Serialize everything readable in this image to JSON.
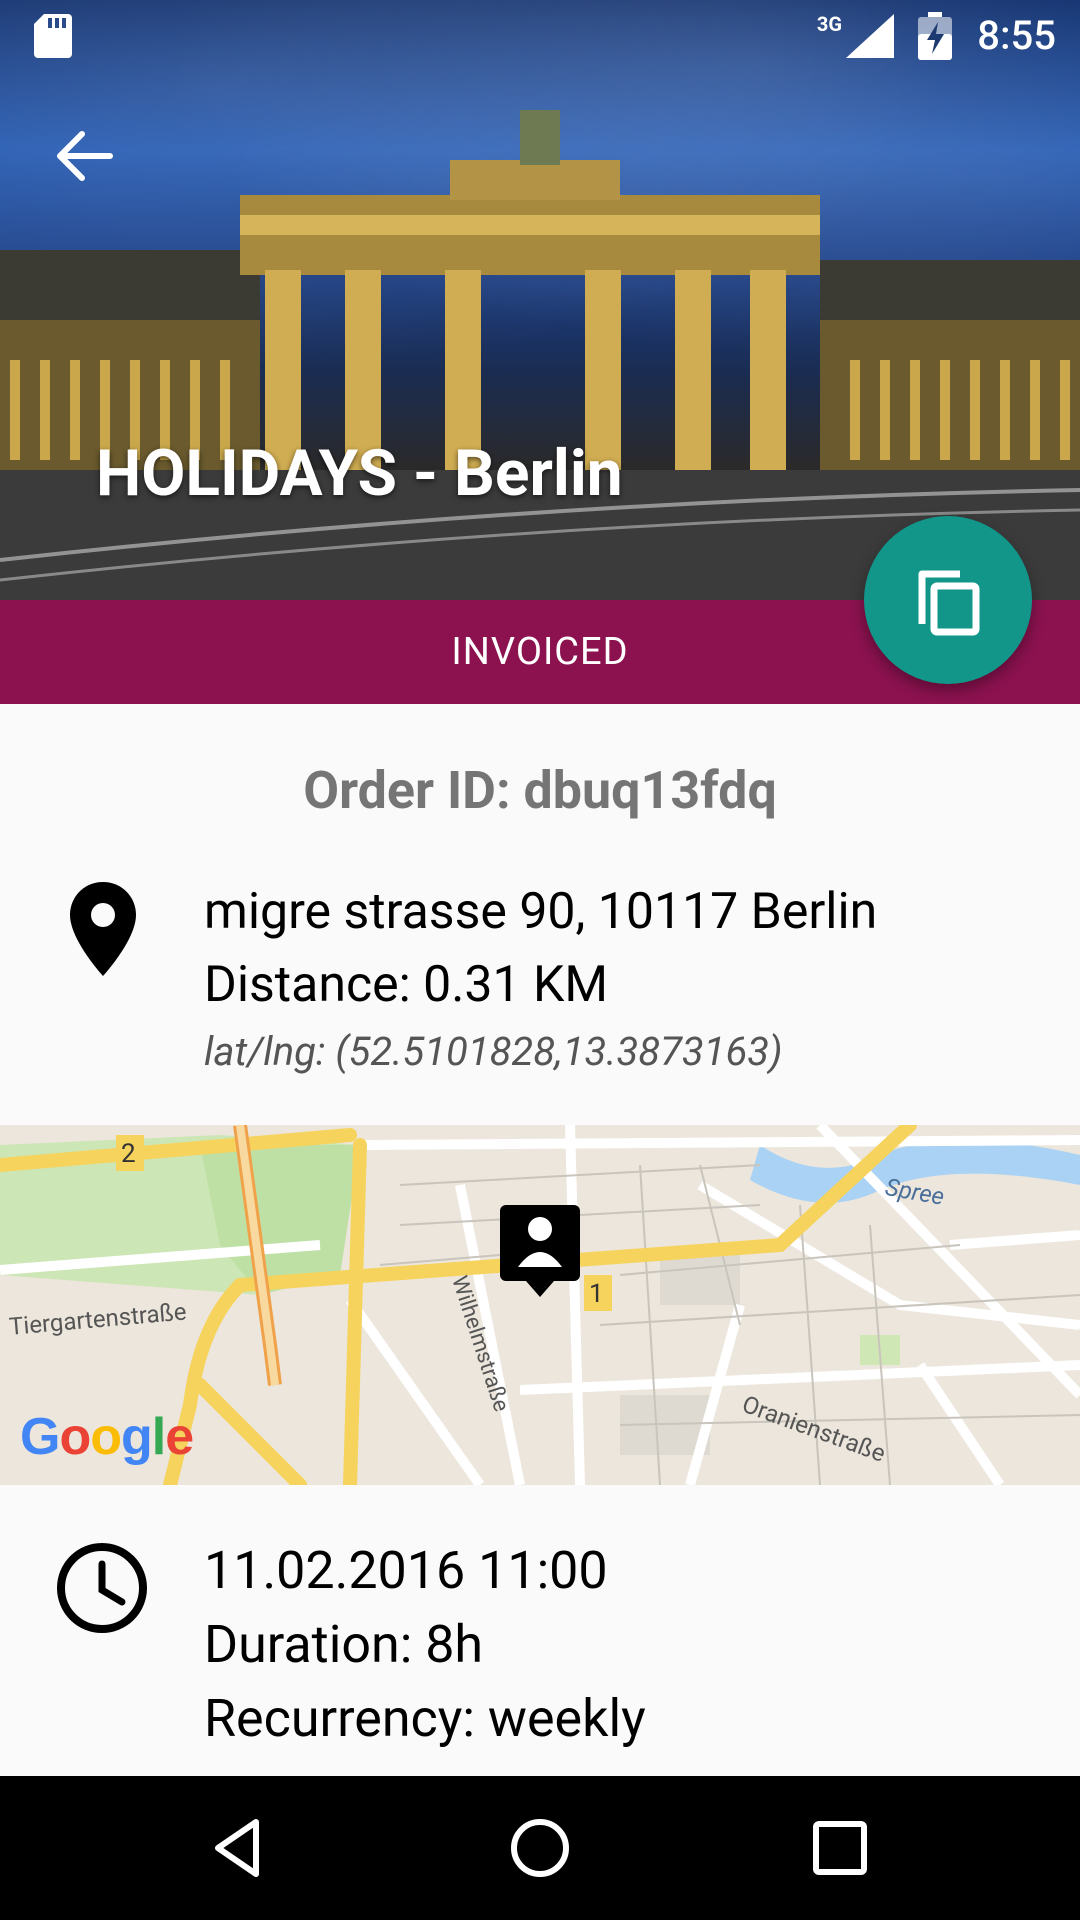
{
  "status_bar": {
    "time": "8:55",
    "network": "3G"
  },
  "header": {
    "title": "HOLIDAYS - Berlin"
  },
  "status": {
    "label": "INVOICED",
    "color": "#8b124f"
  },
  "fab": {
    "icon": "copy-icon",
    "color": "#12968a"
  },
  "order": {
    "id_text": "Order ID: dbuq13fdq"
  },
  "address": {
    "street": "migre strasse 90, 10117 Berlin",
    "distance": "Distance: 0.31 KM",
    "latlng": "lat/lng: (52.5101828,13.3873163)"
  },
  "map": {
    "labels": {
      "tiergarten": "Tiergartenstraße",
      "wilhelm": "Wilhelmstraße",
      "oranien": "Oranienstraße",
      "spree": "Spree",
      "route1": "1",
      "route2": "2"
    },
    "logo": "Google"
  },
  "schedule": {
    "datetime": "11.02.2016 11:00",
    "duration": "Duration: 8h",
    "recurrency": "Recurrency: weekly"
  }
}
